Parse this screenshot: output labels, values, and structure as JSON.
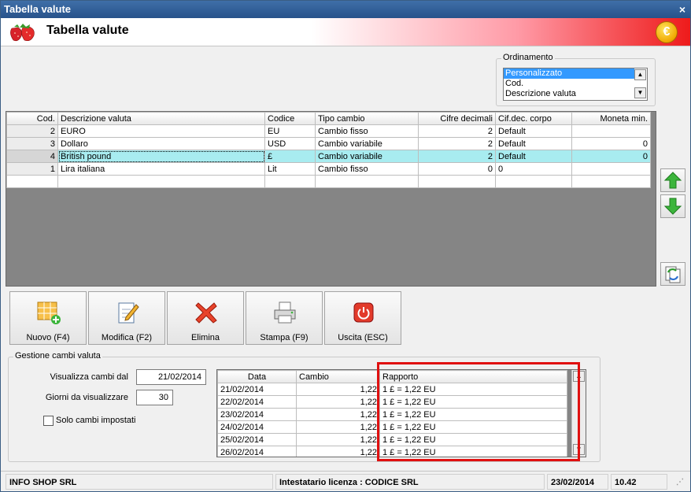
{
  "window": {
    "title": "Tabella valute",
    "close_glyph": "×"
  },
  "header": {
    "title": "Tabella valute",
    "logo_icon": "strawberries-icon",
    "coin_icon": "euro-coin-icon",
    "coin_symbol": "€"
  },
  "ordinamento": {
    "legend": "Ordinamento",
    "options": [
      "Personalizzato",
      "Cod.",
      "Descrizione valuta"
    ],
    "selected": "Personalizzato"
  },
  "valute_table": {
    "columns": [
      "Cod.",
      "Descrizione valuta",
      "Codice",
      "Tipo cambio",
      "Cifre decimali",
      "Cif.dec. corpo",
      "Moneta min."
    ],
    "rows": [
      {
        "cod": "2",
        "descrizione": "EURO",
        "codice": "EU",
        "tipo": "Cambio fisso",
        "cifre": "2",
        "corpo": "Default",
        "moneta": ""
      },
      {
        "cod": "3",
        "descrizione": "Dollaro",
        "codice": "USD",
        "tipo": "Cambio variabile",
        "cifre": "2",
        "corpo": "Default",
        "moneta": "0"
      },
      {
        "cod": "4",
        "descrizione": "British pound",
        "codice": "£",
        "tipo": "Cambio variabile",
        "cifre": "2",
        "corpo": "Default",
        "moneta": "0"
      },
      {
        "cod": "1",
        "descrizione": "Lira italiana",
        "codice": "Lit",
        "tipo": "Cambio fisso",
        "cifre": "0",
        "corpo": "0",
        "moneta": ""
      }
    ],
    "selected_row": 2
  },
  "side_buttons": [
    "arrow-up-icon",
    "arrow-down-icon",
    "refresh-icon"
  ],
  "toolbar": {
    "nuovo": "Nuovo (F4)",
    "modifica": "Modifica (F2)",
    "elimina": "Elimina",
    "stampa": "Stampa (F9)",
    "uscita": "Uscita (ESC)"
  },
  "gestione": {
    "legend": "Gestione cambi valuta",
    "visualizza_label": "Visualizza cambi dal",
    "visualizza_value": "21/02/2014",
    "giorni_label": "Giorni da visualizzare",
    "giorni_value": "30",
    "solo_label": "Solo cambi impostati",
    "solo_checked": false
  },
  "cambi_table": {
    "columns": [
      "Data",
      "Cambio",
      "Rapporto"
    ],
    "rows": [
      {
        "data": "21/02/2014",
        "cambio": "1,22",
        "rapporto": "1 £ = 1,22 EU"
      },
      {
        "data": "22/02/2014",
        "cambio": "1,22",
        "rapporto": "1 £ = 1,22 EU"
      },
      {
        "data": "23/02/2014",
        "cambio": "1,22",
        "rapporto": "1 £ = 1,22 EU"
      },
      {
        "data": "24/02/2014",
        "cambio": "1,22",
        "rapporto": "1 £ = 1,22 EU"
      },
      {
        "data": "25/02/2014",
        "cambio": "1,22",
        "rapporto": "1 £ = 1,22 EU"
      },
      {
        "data": "26/02/2014",
        "cambio": "1,22",
        "rapporto": "1 £ = 1,22 EU"
      }
    ]
  },
  "status_bar": {
    "company": "INFO SHOP SRL",
    "licenza": "Intestatario licenza : CODICE SRL",
    "date": "23/02/2014",
    "version": "10.42"
  },
  "colors": {
    "selected_row": "#a8ecf0",
    "highlight_box": "#e01010",
    "banner_red": "#ee1b1b"
  }
}
